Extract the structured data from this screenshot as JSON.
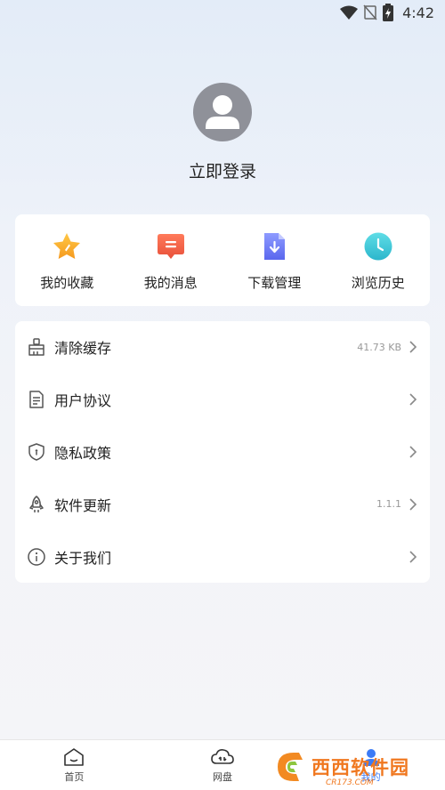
{
  "status_bar": {
    "time": "4:42"
  },
  "profile": {
    "login_text": "立即登录"
  },
  "shortcuts": [
    {
      "label": "我的收藏",
      "icon": "star-icon",
      "color": "#f5a623"
    },
    {
      "label": "我的消息",
      "icon": "message-icon",
      "color": "#f26a4b"
    },
    {
      "label": "下载管理",
      "icon": "download-file-icon",
      "color": "#6b7cf6"
    },
    {
      "label": "浏览历史",
      "icon": "clock-icon",
      "color": "#3cc4d6"
    }
  ],
  "menu": [
    {
      "label": "清除缓存",
      "value": "41.73 KB",
      "icon": "broom-icon"
    },
    {
      "label": "用户协议",
      "value": "",
      "icon": "document-icon"
    },
    {
      "label": "隐私政策",
      "value": "",
      "icon": "shield-icon"
    },
    {
      "label": "软件更新",
      "value": "1.1.1",
      "icon": "rocket-icon"
    },
    {
      "label": "关于我们",
      "value": "",
      "icon": "info-icon"
    }
  ],
  "bottom_nav": [
    {
      "label": "首页",
      "icon": "home-icon"
    },
    {
      "label": "网盘",
      "icon": "cloud-icon"
    },
    {
      "label": "我的",
      "icon": "user-icon"
    }
  ],
  "watermark": {
    "text": "西西软件园",
    "sub": "CR173.COM"
  }
}
